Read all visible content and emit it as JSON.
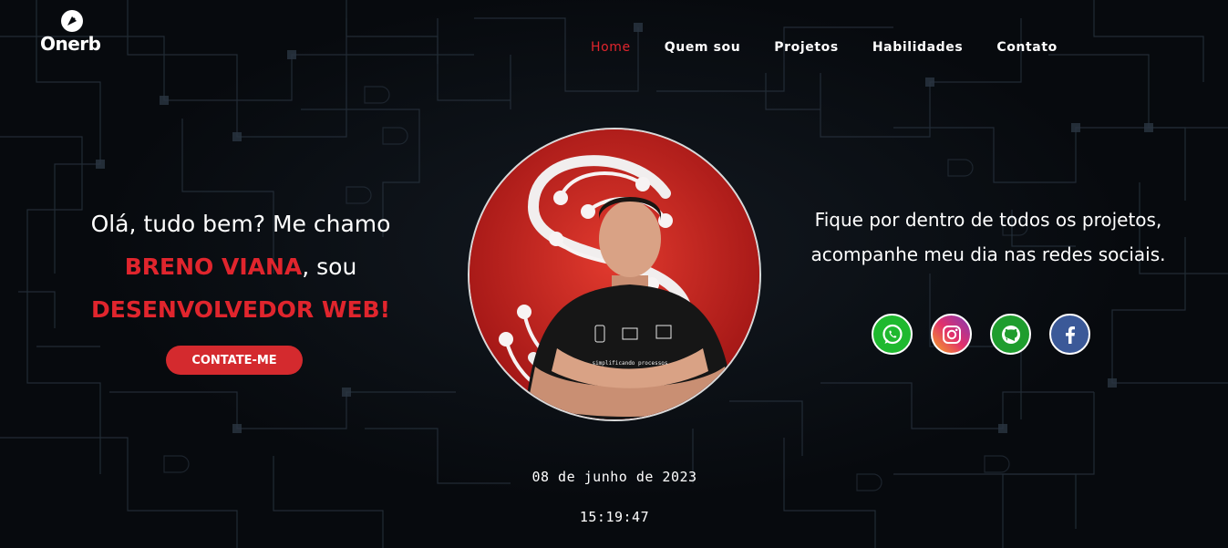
{
  "brand": {
    "logo_text": "Onerb"
  },
  "nav": {
    "items": [
      {
        "label": "Home",
        "active": true
      },
      {
        "label": "Quem sou",
        "active": false
      },
      {
        "label": "Projetos",
        "active": false
      },
      {
        "label": "Habilidades",
        "active": false
      },
      {
        "label": "Contato",
        "active": false
      }
    ]
  },
  "hero": {
    "greeting": "Olá, tudo bem? Me chamo",
    "name": "BRENO VIANA",
    "name_suffix": ", sou",
    "role": "DESENVOLVEDOR WEB!",
    "cta_label": "CONTATE-ME"
  },
  "profile": {
    "shirt_text": "simplificando processos"
  },
  "follow": {
    "text": "Fique por dentro de todos os projetos, acompanhe meu dia nas redes sociais.",
    "socials": [
      {
        "network": "whatsapp",
        "icon": "whatsapp-icon",
        "color": "#1fb92f"
      },
      {
        "network": "instagram",
        "icon": "instagram-icon",
        "color": "#e1306c"
      },
      {
        "network": "github",
        "icon": "github-icon",
        "color": "#1f9d2e"
      },
      {
        "network": "facebook",
        "icon": "facebook-icon",
        "color": "#3b5998"
      }
    ]
  },
  "clock": {
    "date": "08 de junho de 2023",
    "time": "15:19:47"
  },
  "colors": {
    "accent": "#e0252d",
    "background": "#070a0e"
  }
}
